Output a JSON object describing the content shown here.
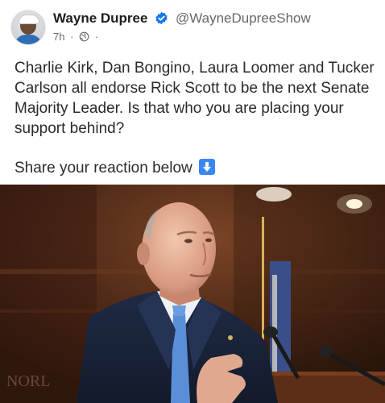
{
  "author": {
    "name": "Wayne Dupree",
    "handle": "@WayneDupreeShow"
  },
  "meta": {
    "time": "7h",
    "separator": "·",
    "audience_icon": "globe-icon"
  },
  "post": {
    "text": "Charlie Kirk, Dan Bongino, Laura Loomer and Tucker Carlson all endorse Rick Scott to be the next Senate Majority Leader. Is that who you are placing your support behind?",
    "reaction_prompt": "Share your reaction below",
    "reaction_emoji": "down-arrow-emoji-icon"
  },
  "colors": {
    "verified": "#1877f2",
    "secondary_text": "#65676b",
    "emoji_blue": "#3b88f5"
  }
}
